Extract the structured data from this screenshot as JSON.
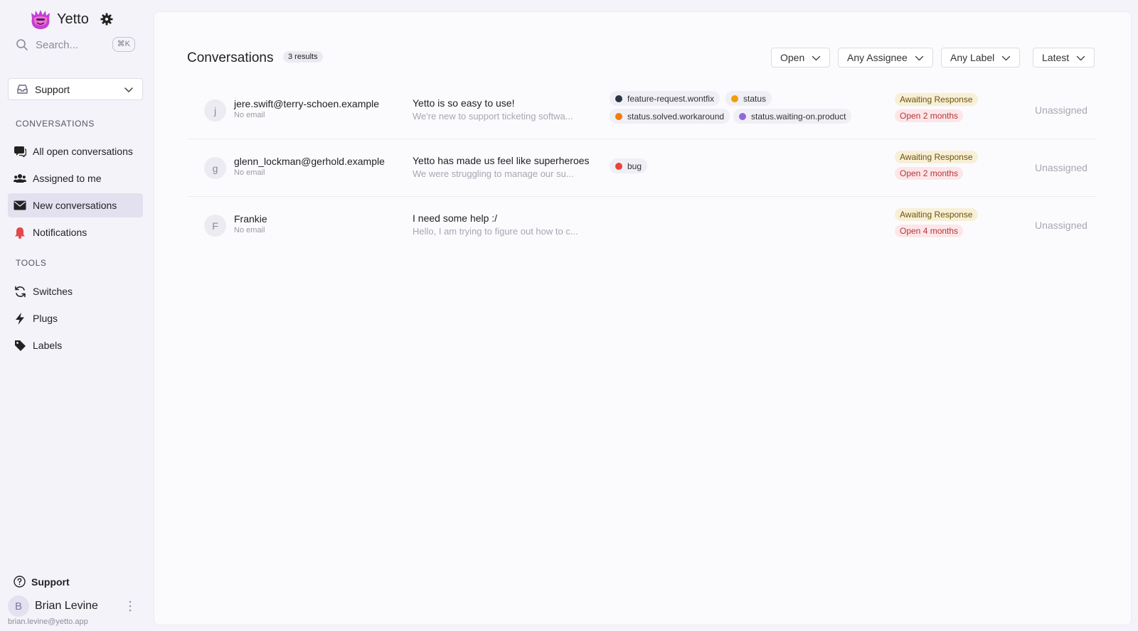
{
  "app": {
    "name": "Yetto"
  },
  "search": {
    "placeholder": "Search...",
    "shortcut": "⌘K"
  },
  "team": {
    "label": "Support"
  },
  "sidebar": {
    "conversations_title": "CONVERSATIONS",
    "conversations": [
      {
        "label": "All open conversations",
        "icon": "chat-bubbles-icon",
        "active": false
      },
      {
        "label": "Assigned to me",
        "icon": "users-icon",
        "active": false
      },
      {
        "label": "New conversations",
        "icon": "envelope-icon",
        "active": true
      },
      {
        "label": "Notifications",
        "icon": "bell-icon",
        "active": false
      }
    ],
    "tools_title": "TOOLS",
    "tools": [
      {
        "label": "Switches",
        "icon": "sync-icon"
      },
      {
        "label": "Plugs",
        "icon": "bolt-icon"
      },
      {
        "label": "Labels",
        "icon": "tag-icon"
      }
    ],
    "support_label": "Support",
    "user": {
      "initial": "B",
      "name": "Brian Levine",
      "email": "brian.levine@yetto.app"
    }
  },
  "main": {
    "title": "Conversations",
    "count": "3 results",
    "filters": {
      "state": "Open",
      "assignee": "Any Assignee",
      "label": "Any Label",
      "sort": "Latest"
    },
    "rows": [
      {
        "initial": "j",
        "from": "jere.swift@terry-schoen.example",
        "email": "No email",
        "subject": "Yetto is so easy to use!",
        "preview": "We're new to support ticketing softwa...",
        "tags": [
          {
            "label": "feature-request.wontfix",
            "color": "#2b3345"
          },
          {
            "label": "status",
            "color": "#f29d0f"
          },
          {
            "label": "status.solved.workaround",
            "color": "#f27a0f"
          },
          {
            "label": "status.waiting-on.product",
            "color": "#9066e0"
          }
        ],
        "status": "Awaiting Response",
        "age": "Open 2 months",
        "assignee": "Unassigned"
      },
      {
        "initial": "g",
        "from": "glenn_lockman@gerhold.example",
        "email": "No email",
        "subject": "Yetto has made us feel like superheroes",
        "preview": "We were struggling to manage our su...",
        "tags": [
          {
            "label": "bug",
            "color": "#e8433c"
          }
        ],
        "status": "Awaiting Response",
        "age": "Open 2 months",
        "assignee": "Unassigned"
      },
      {
        "initial": "F",
        "from": "Frankie",
        "email": "No email",
        "subject": "I need some help :/",
        "preview": "Hello, I am trying to figure out how to c...",
        "tags": [],
        "status": "Awaiting Response",
        "age": "Open 4 months",
        "assignee": "Unassigned"
      }
    ]
  }
}
